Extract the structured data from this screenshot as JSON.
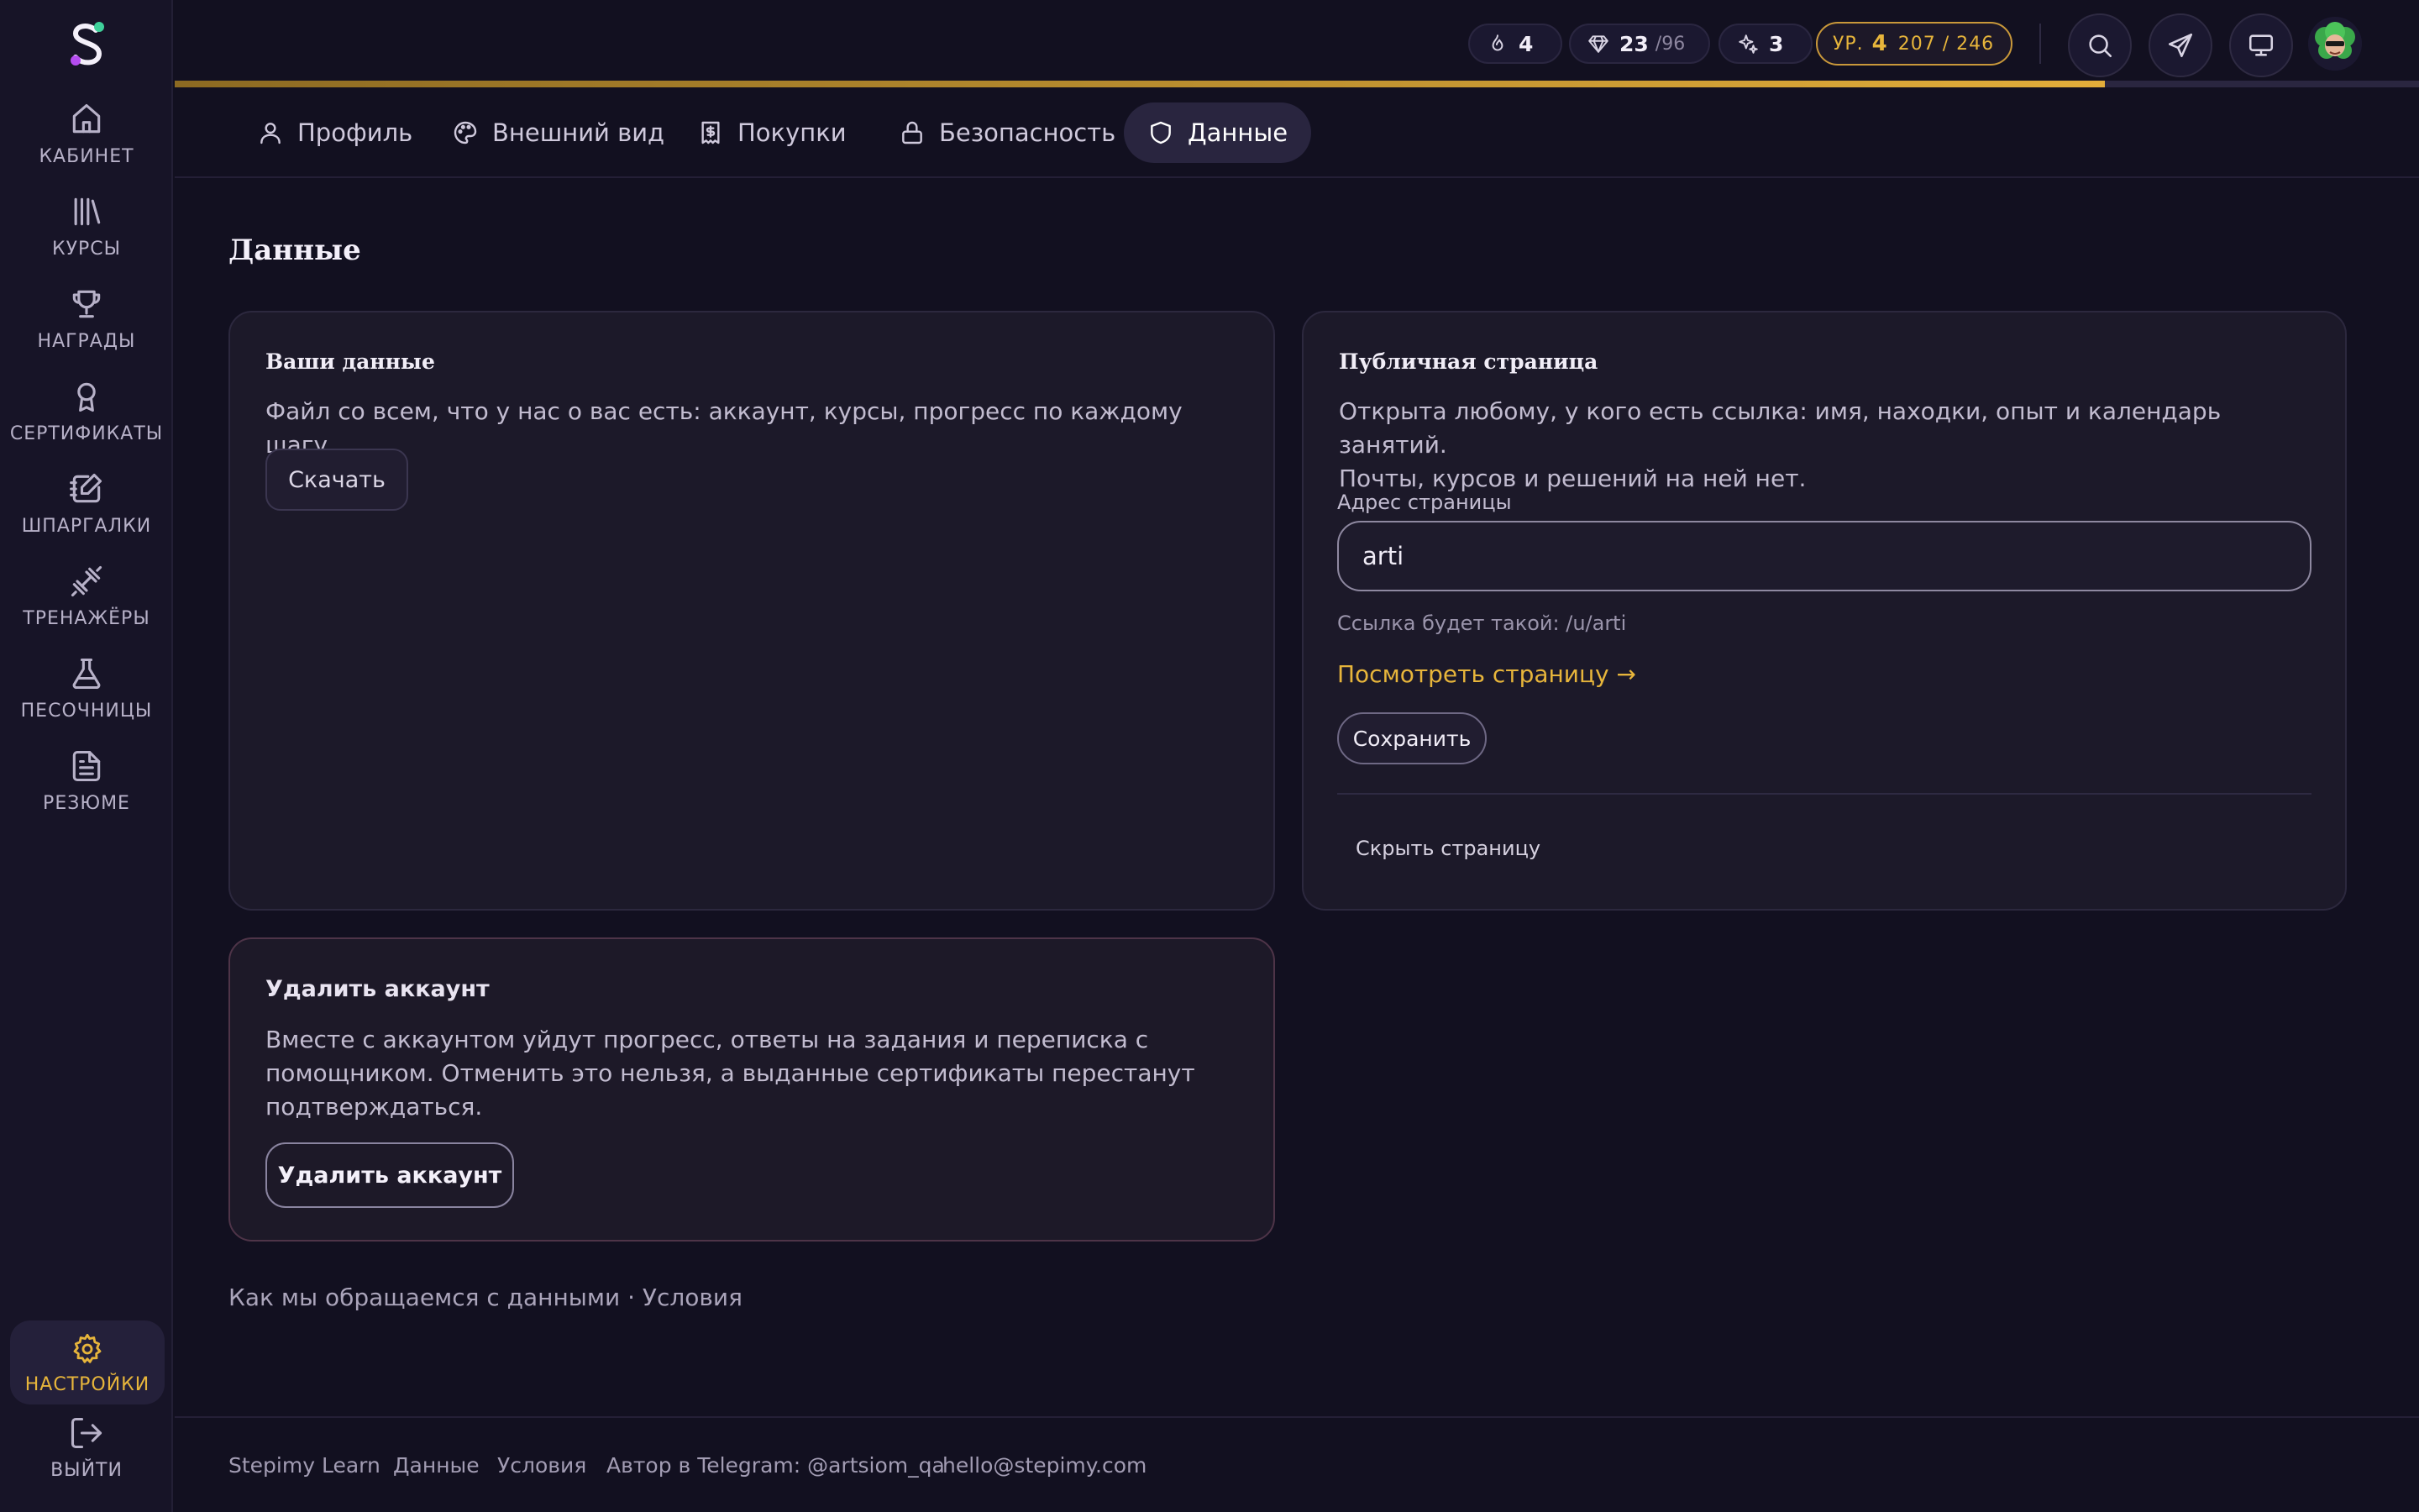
{
  "app": {
    "name": "Stepimy Learn"
  },
  "sidebar": {
    "items": [
      {
        "label": "КАБИНЕТ",
        "icon": "home-icon"
      },
      {
        "label": "КУРСЫ",
        "icon": "library-icon"
      },
      {
        "label": "НАГРАДЫ",
        "icon": "trophy-icon"
      },
      {
        "label": "СЕРТИФИКАТЫ",
        "icon": "award-icon"
      },
      {
        "label": "ШПАРГАЛКИ",
        "icon": "notebook-pen-icon"
      },
      {
        "label": "ТРЕНАЖЁРЫ",
        "icon": "dumbbell-icon"
      },
      {
        "label": "ПЕСОЧНИЦЫ",
        "icon": "flask-icon"
      },
      {
        "label": "РЕЗЮМЕ",
        "icon": "file-text-icon"
      }
    ],
    "settings": {
      "label": "НАСТРОЙКИ",
      "icon": "gear-icon"
    },
    "logout": {
      "label": "ВЫЙТИ",
      "icon": "logout-icon"
    }
  },
  "header": {
    "streak": "4",
    "gems": "23",
    "gems_max": "/96",
    "sparkles": "3",
    "level_prefix": "УР.",
    "level": "4",
    "xp": "207 / 246",
    "xp_progress": 0.86
  },
  "tabs": [
    {
      "label": "Профиль",
      "icon": "user-icon"
    },
    {
      "label": "Внешний вид",
      "icon": "palette-icon"
    },
    {
      "label": "Покупки",
      "icon": "receipt-icon"
    },
    {
      "label": "Безопасность",
      "icon": "lock-icon"
    },
    {
      "label": "Данные",
      "icon": "shield-icon",
      "active": true
    }
  ],
  "page": {
    "title": "Данные",
    "your_data": {
      "title": "Ваши данные",
      "description": "Файл со всем, что у нас о вас есть: аккаунт, курсы, прогресс по каждому шагу.",
      "download": "Скачать"
    },
    "public_page": {
      "title": "Публичная страница",
      "desc_line1": "Открыта любому, у кого есть ссылка: имя, находки, опыт и календарь занятий.",
      "desc_line2": "Почты, курсов и решений на ней нет.",
      "address_label": "Адрес страницы",
      "address_value": "arti",
      "link_hint": "Ссылка будет такой: /u/arti",
      "view_link": "Посмотреть страницу →",
      "save": "Сохранить",
      "hide": "Скрыть страницу"
    },
    "delete_account": {
      "title": "Удалить аккаунт",
      "description": "Вместе с аккаунтом уйдут прогресс, ответы на задания и переписка с помощником. Отменить это нельзя, а выданные сертификаты перестанут подтверждаться.",
      "button": "Удалить аккаунт"
    },
    "data_links": "Как мы обращаемся с данными · Условия"
  },
  "footer": {
    "brand": "Stepimy Learn",
    "data": "Данные",
    "terms": "Условия",
    "telegram": "Автор в Telegram: @artsiom_qa",
    "email": "hello@stepimy.com"
  },
  "colors": {
    "accent": "#e7b53b",
    "background": "#121020",
    "card": "#1c1929"
  }
}
